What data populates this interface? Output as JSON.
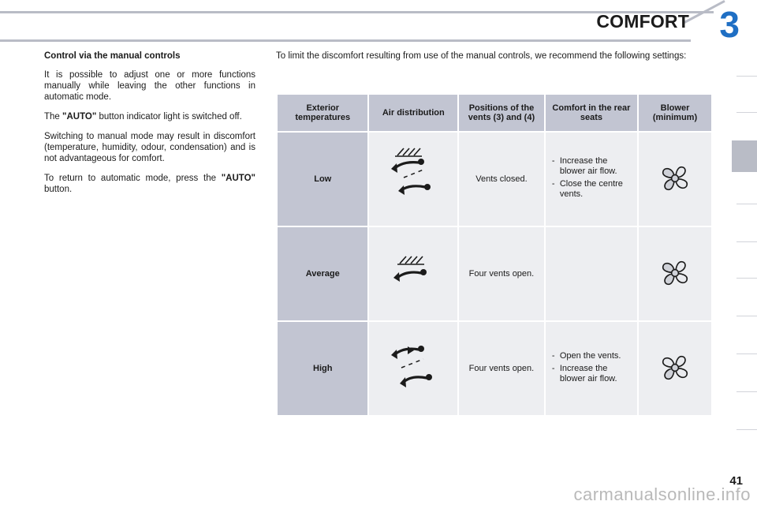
{
  "header": {
    "title": "COMFORT",
    "chapter_number": "3"
  },
  "left_column": {
    "heading": "Control via the manual controls",
    "paragraphs": [
      "It is possible to adjust one or more functions manually while leaving the other functions in automatic mode.",
      "Switching to manual mode may result in discomfort (temperature, humidity, odour, condensation) and is not advantageous for comfort."
    ],
    "auto_paragraph_before": "The ",
    "auto_label": "\"AUTO\"",
    "auto_paragraph_after": " button indicator light is switched off.",
    "return_paragraph_before": "To return to automatic mode, press the ",
    "return_auto_label": "\"AUTO\"",
    "return_paragraph_after": " button."
  },
  "intro": "To limit the discomfort resulting from use of the manual controls, we recommend the following settings:",
  "table": {
    "headers": [
      "Exterior temperatures",
      "Air distribution",
      "Positions of the vents (3) and (4)",
      "Comfort in the rear seats",
      "Blower (minimum)"
    ],
    "rows": [
      {
        "label": "Low",
        "air_distribution_icon": "air-flow-windscreen-and-feet-icon",
        "vents": "Vents closed.",
        "rear_comfort": [
          "Increase the blower air flow.",
          "Close the centre vents."
        ],
        "blower_icon": "fan-speed-2-icon"
      },
      {
        "label": "Average",
        "air_distribution_icon": "air-flow-windscreen-icon",
        "vents": "Four vents open.",
        "rear_comfort": [],
        "blower_icon": "fan-speed-2-icon"
      },
      {
        "label": "High",
        "air_distribution_icon": "air-flow-face-and-feet-icon",
        "vents": "Four vents open.",
        "rear_comfort": [
          "Open the vents.",
          "Increase the blower air flow."
        ],
        "blower_icon": "fan-speed-3-icon"
      }
    ]
  },
  "footer": {
    "page_number": "41",
    "watermark": "carmanualsonline.info"
  },
  "colors": {
    "accent_blue": "#1f6fc4",
    "header_rule": "#b9bcc6",
    "table_head_bg": "#c2c5d2",
    "table_cell_bg": "#edeef1"
  }
}
